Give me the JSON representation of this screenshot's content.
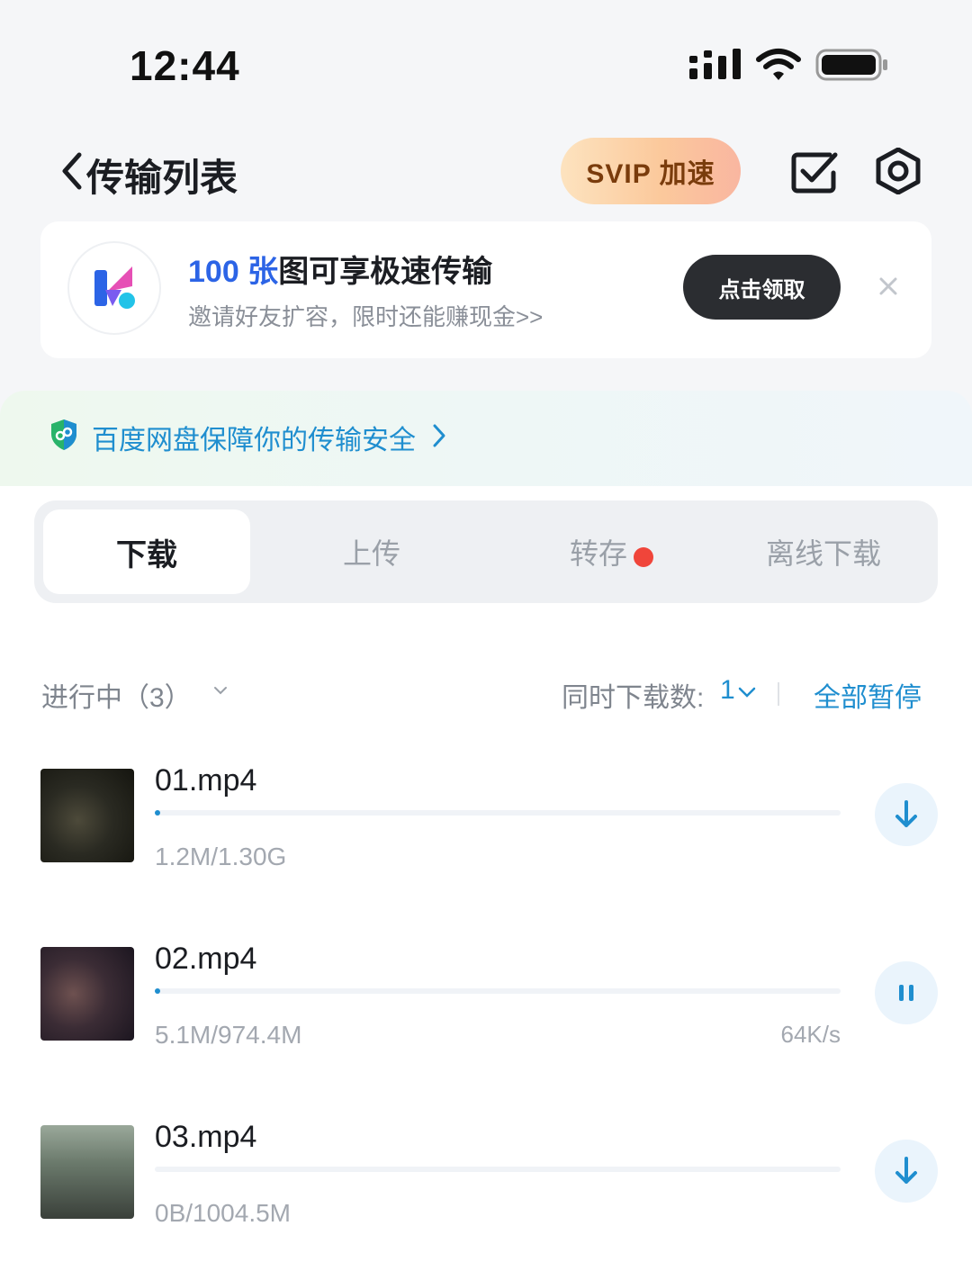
{
  "status_bar": {
    "time": "12:44"
  },
  "nav": {
    "title": "传输列表",
    "svip_label": "SVIP 加速"
  },
  "promo": {
    "title_num": "100 张",
    "title_rest": "图可享极速传输",
    "subtitle": "邀请好友扩容，限时还能赚现金>>",
    "claim_label": "点击领取"
  },
  "security": {
    "text": "百度网盘保障你的传输安全"
  },
  "tabs": [
    {
      "label": "下载",
      "active": true
    },
    {
      "label": "上传",
      "active": false
    },
    {
      "label": "转存",
      "active": false,
      "badge": true
    },
    {
      "label": "离线下载",
      "active": false
    }
  ],
  "section": {
    "label": "进行中（3）",
    "concurrent_label": "同时下载数:",
    "concurrent_value": "1",
    "pause_all": "全部暂停"
  },
  "files": [
    {
      "name": "01.mp4",
      "size": "1.2M/1.30G",
      "speed": "",
      "progress": 0.001,
      "action": "download-icon"
    },
    {
      "name": "02.mp4",
      "size": "5.1M/974.4M",
      "speed": "64K/s",
      "progress": 0.005,
      "action": "pause-icon"
    },
    {
      "name": "03.mp4",
      "size": "0B/1004.5M",
      "speed": "",
      "progress": 0,
      "action": "download-icon"
    }
  ],
  "colors": {
    "accent": "#1f8ecf",
    "brand_blue": "#2c64e6",
    "badge": "#f0453a"
  }
}
